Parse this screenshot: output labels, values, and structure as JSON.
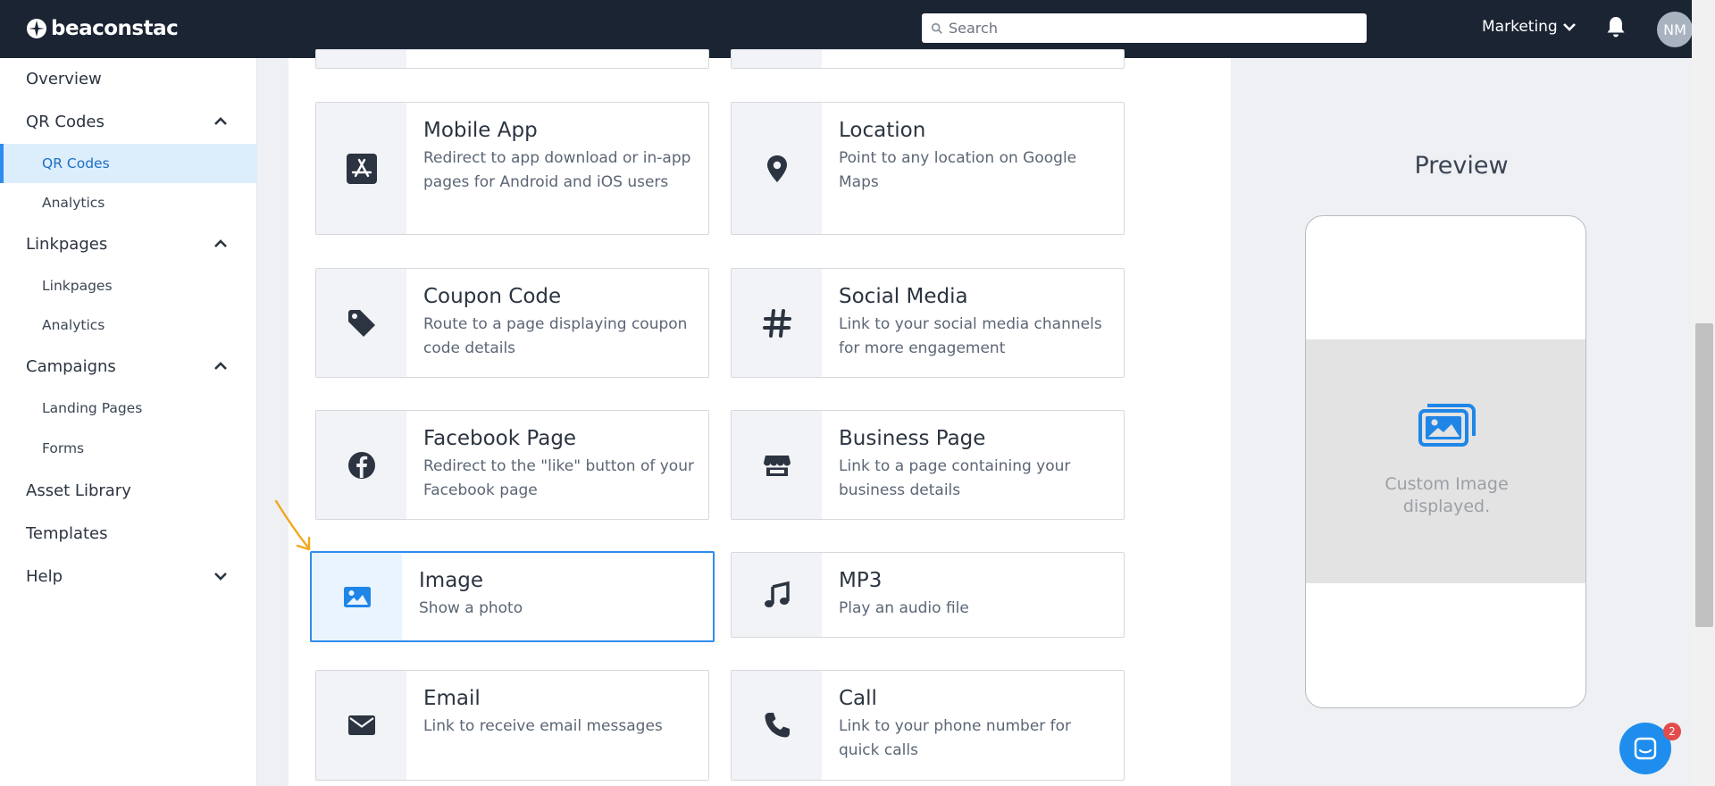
{
  "header": {
    "brand": "beaconstac",
    "search_placeholder": "Search",
    "org_name": "Marketing",
    "avatar_initials": "NM"
  },
  "sidebar": {
    "overview": "Overview",
    "qr_group": "QR Codes",
    "qr_codes": "QR Codes",
    "qr_analytics": "Analytics",
    "linkpages_group": "Linkpages",
    "linkpages": "Linkpages",
    "linkpages_analytics": "Analytics",
    "campaigns_group": "Campaigns",
    "landing_pages": "Landing Pages",
    "forms": "Forms",
    "asset_library": "Asset Library",
    "templates": "Templates",
    "help": "Help"
  },
  "campaign_types": [
    {
      "title": "Mobile App",
      "description": "Redirect to app download or in-app pages for Android and iOS users",
      "icon": "app-store-icon"
    },
    {
      "title": "Location",
      "description": "Point to any location on Google Maps",
      "icon": "map-pin-icon"
    },
    {
      "title": "Coupon Code",
      "description": "Route to a page displaying coupon code details",
      "icon": "tag-icon"
    },
    {
      "title": "Social Media",
      "description": "Link to your social media channels for more engagement",
      "icon": "hashtag-icon"
    },
    {
      "title": "Facebook Page",
      "description": "Redirect to the \"like\" button of your Facebook page",
      "icon": "facebook-icon"
    },
    {
      "title": "Business Page",
      "description": "Link to a page containing your business details",
      "icon": "store-icon"
    },
    {
      "title": "Image",
      "description": "Show a photo",
      "icon": "image-icon",
      "selected": true
    },
    {
      "title": "MP3",
      "description": "Play an audio file",
      "icon": "music-note-icon"
    },
    {
      "title": "Email",
      "description": "Link to receive email messages",
      "icon": "envelope-icon"
    },
    {
      "title": "Call",
      "description": "Link to your phone number for quick calls",
      "icon": "phone-icon"
    }
  ],
  "preview": {
    "title": "Preview",
    "caption_line1": "Custom Image",
    "caption_line2": "displayed."
  },
  "chat": {
    "unread": "2"
  },
  "colors": {
    "topbar": "#1a2433",
    "accent": "#2f8cec",
    "annotation_arrow": "#f2a81d"
  }
}
